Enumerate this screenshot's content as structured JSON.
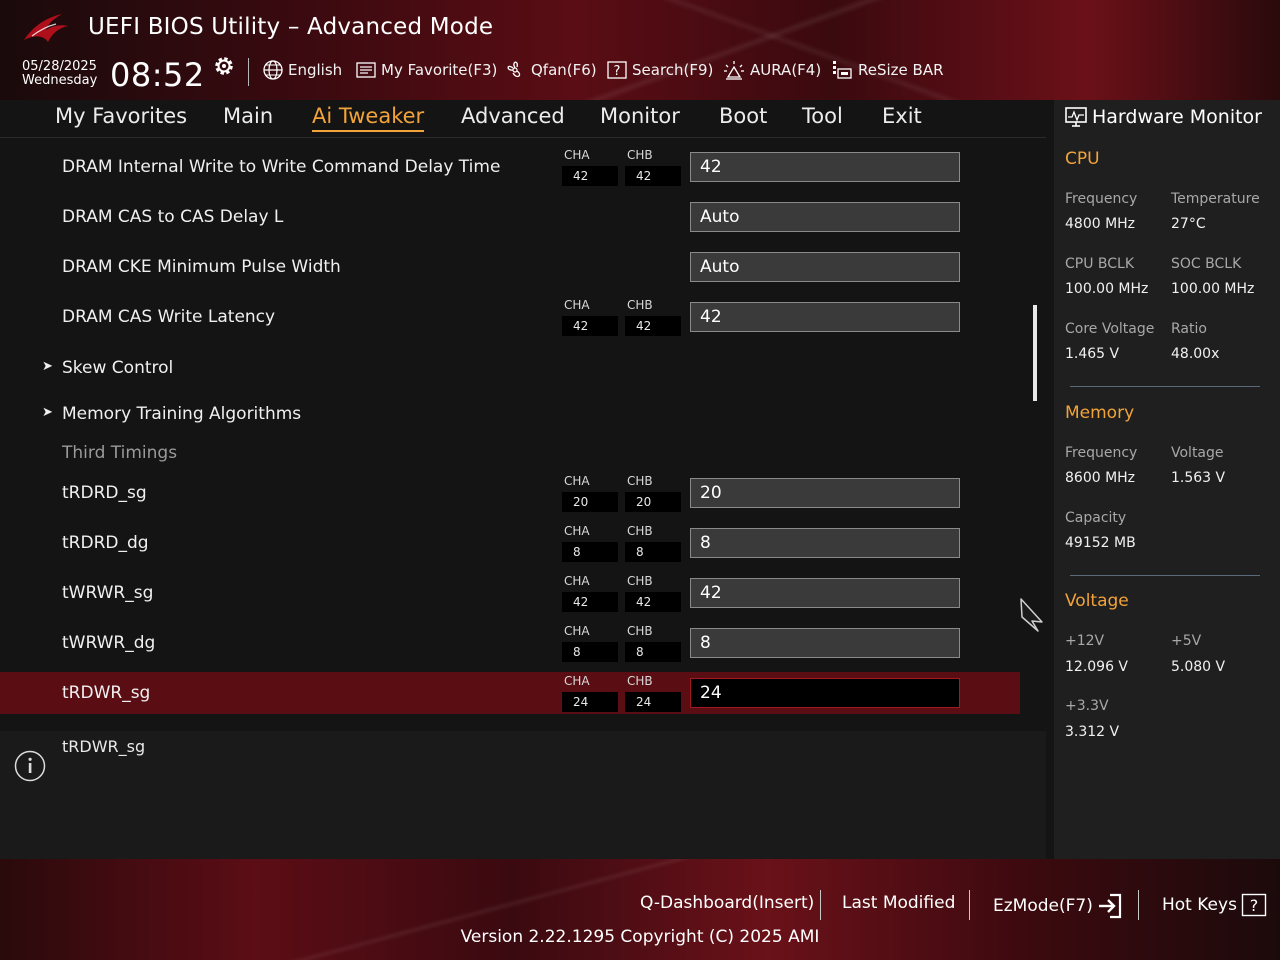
{
  "header": {
    "title": "UEFI BIOS Utility – Advanced Mode",
    "date": "05/28/2025",
    "weekday": "Wednesday",
    "time": "08:52",
    "toolbar": {
      "language": "English",
      "favorite": "My Favorite(F3)",
      "qfan": "Qfan(F6)",
      "search": "Search(F9)",
      "aura": "AURA(F4)",
      "resize_bar": "ReSize BAR"
    }
  },
  "nav": {
    "tabs": [
      {
        "label": "My Favorites"
      },
      {
        "label": "Main"
      },
      {
        "label": "Ai Tweaker"
      },
      {
        "label": "Advanced"
      },
      {
        "label": "Monitor"
      },
      {
        "label": "Boot"
      },
      {
        "label": "Tool"
      },
      {
        "label": "Exit"
      }
    ],
    "active_tab": "Ai Tweaker"
  },
  "settings": [
    {
      "label": "DRAM Internal Write to Write Command Delay Time",
      "cha": "42",
      "chb": "42",
      "value": "42"
    },
    {
      "label": "DRAM CAS to CAS Delay L",
      "value": "Auto"
    },
    {
      "label": "DRAM CKE Minimum Pulse Width",
      "value": "Auto"
    },
    {
      "label": "DRAM CAS Write Latency",
      "cha": "42",
      "chb": "42",
      "value": "42"
    },
    {
      "label": "Skew Control"
    },
    {
      "label": "Memory Training Algorithms"
    },
    {
      "label": "Third Timings"
    },
    {
      "label": "tRDRD_sg",
      "cha": "20",
      "chb": "20",
      "value": "20"
    },
    {
      "label": "tRDRD_dg",
      "cha": "8",
      "chb": "8",
      "value": "8"
    },
    {
      "label": "tWRWR_sg",
      "cha": "42",
      "chb": "42",
      "value": "42"
    },
    {
      "label": "tWRWR_dg",
      "cha": "8",
      "chb": "8",
      "value": "8"
    },
    {
      "label": "tRDWR_sg",
      "cha": "24",
      "chb": "24",
      "value": "24"
    }
  ],
  "channel_labels": {
    "a": "CHA",
    "b": "CHB"
  },
  "help": {
    "text": "tRDWR_sg"
  },
  "hardware_monitor": {
    "title": "Hardware Monitor",
    "cpu": {
      "heading": "CPU",
      "frequency_label": "Frequency",
      "frequency": "4800 MHz",
      "temperature_label": "Temperature",
      "temperature": "27°C",
      "cpu_bclk_label": "CPU BCLK",
      "cpu_bclk": "100.00 MHz",
      "soc_bclk_label": "SOC BCLK",
      "soc_bclk": "100.00 MHz",
      "core_voltage_label": "Core Voltage",
      "core_voltage": "1.465 V",
      "ratio_label": "Ratio",
      "ratio": "48.00x"
    },
    "memory": {
      "heading": "Memory",
      "frequency_label": "Frequency",
      "frequency": "8600 MHz",
      "voltage_label": "Voltage",
      "voltage": "1.563 V",
      "capacity_label": "Capacity",
      "capacity": "49152 MB"
    },
    "voltage": {
      "heading": "Voltage",
      "v12_label": "+12V",
      "v12": "12.096 V",
      "v5_label": "+5V",
      "v5": "5.080 V",
      "v33_label": "+3.3V",
      "v33": "3.312 V"
    }
  },
  "footer": {
    "qdashboard": "Q-Dashboard(Insert)",
    "last_modified": "Last Modified",
    "ezmode": "EzMode(F7)",
    "hotkeys": "Hot Keys",
    "version": "Version 2.22.1295 Copyright (C) 2025 AMI"
  },
  "colors": {
    "accent": "#f2a33a",
    "selected_row": "#5a0e14",
    "brand_red": "#a01820"
  }
}
